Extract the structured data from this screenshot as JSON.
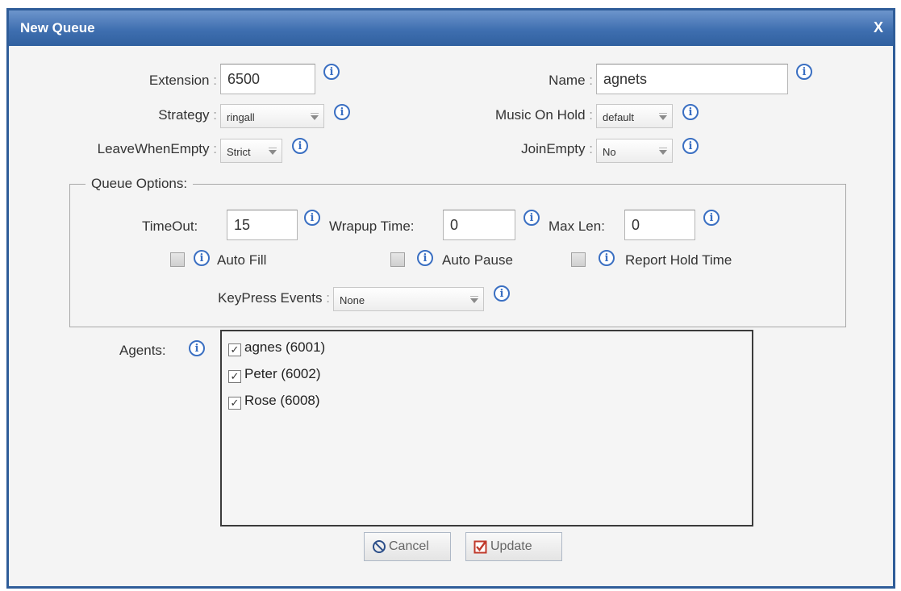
{
  "dialog": {
    "title": "New Queue",
    "close": "X"
  },
  "fields": {
    "extension": {
      "label": "Extension",
      "value": "6500"
    },
    "name": {
      "label": "Name",
      "value": "agnets"
    },
    "strategy": {
      "label": "Strategy",
      "value": "ringall"
    },
    "music_on_hold": {
      "label": "Music On Hold",
      "value": "default"
    },
    "leave_when_empty": {
      "label": "LeaveWhenEmpty",
      "value": "Strict"
    },
    "join_empty": {
      "label": "JoinEmpty",
      "value": "No"
    }
  },
  "queue_options": {
    "legend": "Queue Options:",
    "timeout": {
      "label": "TimeOut:",
      "value": "15"
    },
    "wrapup_time": {
      "label": "Wrapup Time:",
      "value": "0"
    },
    "max_len": {
      "label": "Max Len:",
      "value": "0"
    },
    "auto_fill": {
      "label": "Auto Fill",
      "checked": false
    },
    "auto_pause": {
      "label": "Auto Pause",
      "checked": false
    },
    "report_hold_time": {
      "label": "Report Hold Time",
      "checked": false
    },
    "keypress_events": {
      "label": "KeyPress Events",
      "value": "None"
    }
  },
  "agents": {
    "label": "Agents:",
    "items": [
      {
        "label": "agnes (6001)",
        "checked": true
      },
      {
        "label": "Peter (6002)",
        "checked": true
      },
      {
        "label": "Rose (6008)",
        "checked": true
      }
    ]
  },
  "buttons": {
    "cancel": "Cancel",
    "update": "Update"
  },
  "colors": {
    "title_bar": "#3f6fb0",
    "info_icon": "#3a6fc2",
    "update_icon": "#c0392b"
  },
  "icons": {
    "info": "info-icon",
    "cancel": "no-entry-icon",
    "update": "checked-box-icon"
  },
  "symbols": {
    "info": "i",
    "colon": ":",
    "check": "✓"
  }
}
